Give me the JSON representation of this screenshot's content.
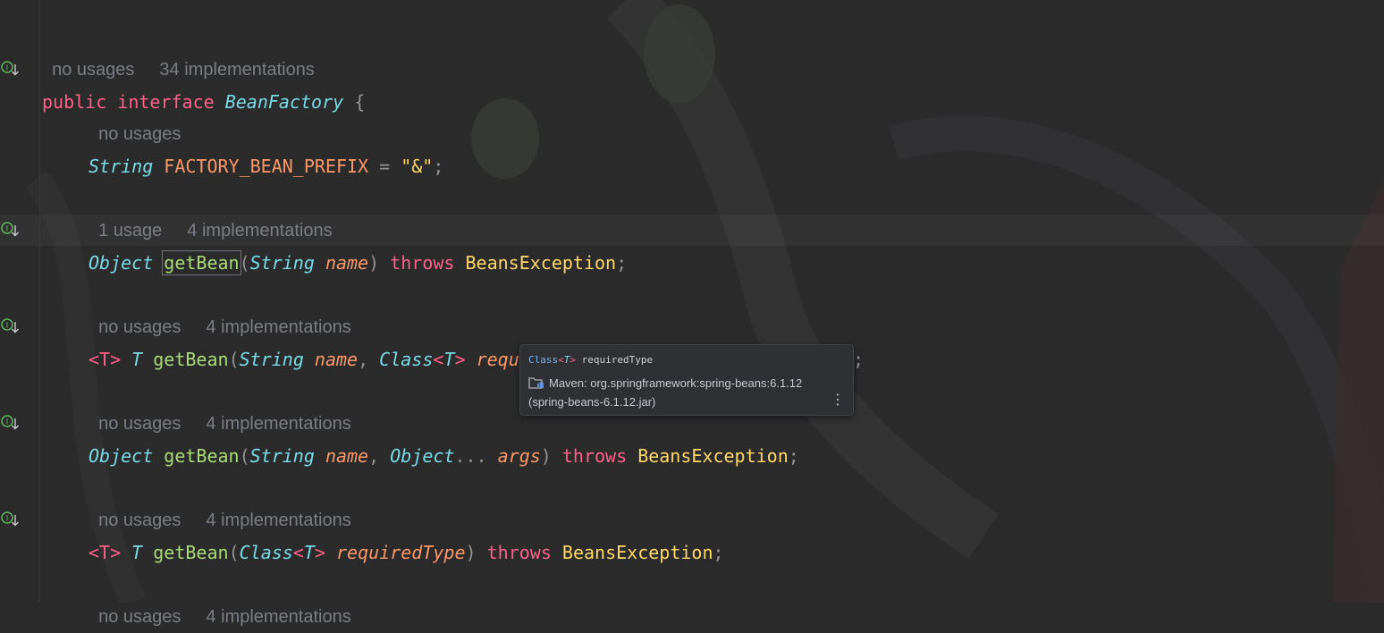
{
  "editor": {
    "lines": [
      {
        "hint": [
          "no usages",
          "34 implementations"
        ]
      },
      {
        "hint": [
          "no usages"
        ]
      },
      {
        "hint": [
          "1 usage",
          "4 implementations"
        ]
      },
      {
        "hint": [
          "no usages",
          "4 implementations"
        ]
      },
      {
        "hint": [
          "no usages",
          "4 implementations"
        ]
      },
      {
        "hint": [
          "no usages",
          "4 implementations"
        ]
      },
      {
        "hint": [
          "no usages",
          "4 implementations"
        ]
      }
    ],
    "tokens": {
      "public": "public",
      "interface": "interface",
      "BeanFactory": "BeanFactory",
      "open_brace": " {",
      "String": "String",
      "FACTORY_BEAN_PREFIX": "FACTORY_BEAN_PREFIX",
      "equals": " = ",
      "amp_string": "\"&\"",
      "semicolon": ";",
      "Object": "Object",
      "getBean": "getBean",
      "lparen": "(",
      "rparen": ")",
      "name": "name",
      "throws": "throws",
      "BeansException": "BeansException",
      "T_generic": "<T>",
      "T": "T",
      "Class": "Class",
      "requiredType": "requiredType",
      "comma": ", ",
      "ellipsis": "...",
      "args": "args",
      "lt": "<",
      "gt": ">"
    }
  },
  "popup": {
    "sig_class": "Class",
    "sig_lt": "<",
    "sig_T": "T",
    "sig_gt": ">",
    "sig_name": "requiredType",
    "maven_line1": "Maven: org.springframework:spring-beans:6.1.12",
    "maven_line2": "(spring-beans-6.1.12.jar)",
    "more": "⋮"
  },
  "colors": {
    "background": "#2b2b2c",
    "keyword": "#ff6188",
    "type": "#78dce8",
    "function": "#a9dc76",
    "parameter": "#fc9867",
    "string": "#ffd866",
    "hint": "#7a7e85",
    "gutter_icon": "#5fb85a"
  },
  "icons": {
    "gutter": "implemented-interface-arrow-down-icon",
    "maven": "maven-library-icon",
    "more": "more-vertical-icon"
  }
}
